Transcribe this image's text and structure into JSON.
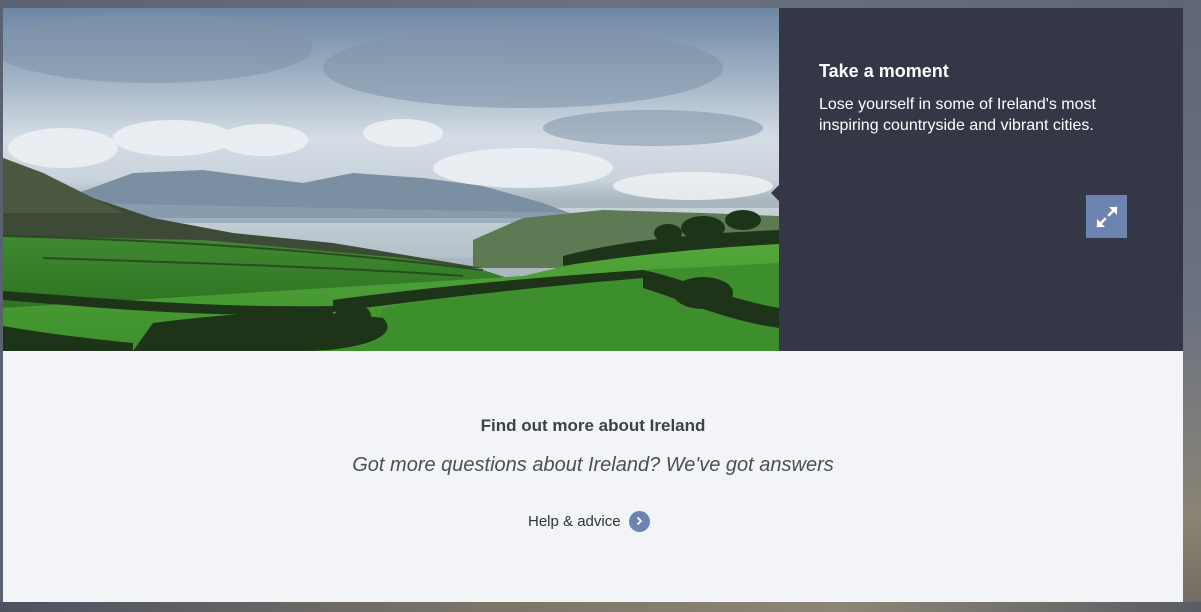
{
  "hero": {
    "image_alt": "Irish countryside with green fields, hills and sea",
    "panel": {
      "title": "Take a moment",
      "text": "Lose yourself in some of Ireland's most inspiring countryside and vibrant cities.",
      "expand_icon": "expand-arrows-icon"
    }
  },
  "info": {
    "heading": "Find out more about Ireland",
    "subheading": "Got more questions about Ireland? We've got answers",
    "link_label": "Help & advice",
    "link_icon": "chevron-right-circle-icon"
  },
  "colors": {
    "panel_bg": "#343846",
    "accent": "#6d83b0",
    "section_bg": "#f3f4f7"
  }
}
